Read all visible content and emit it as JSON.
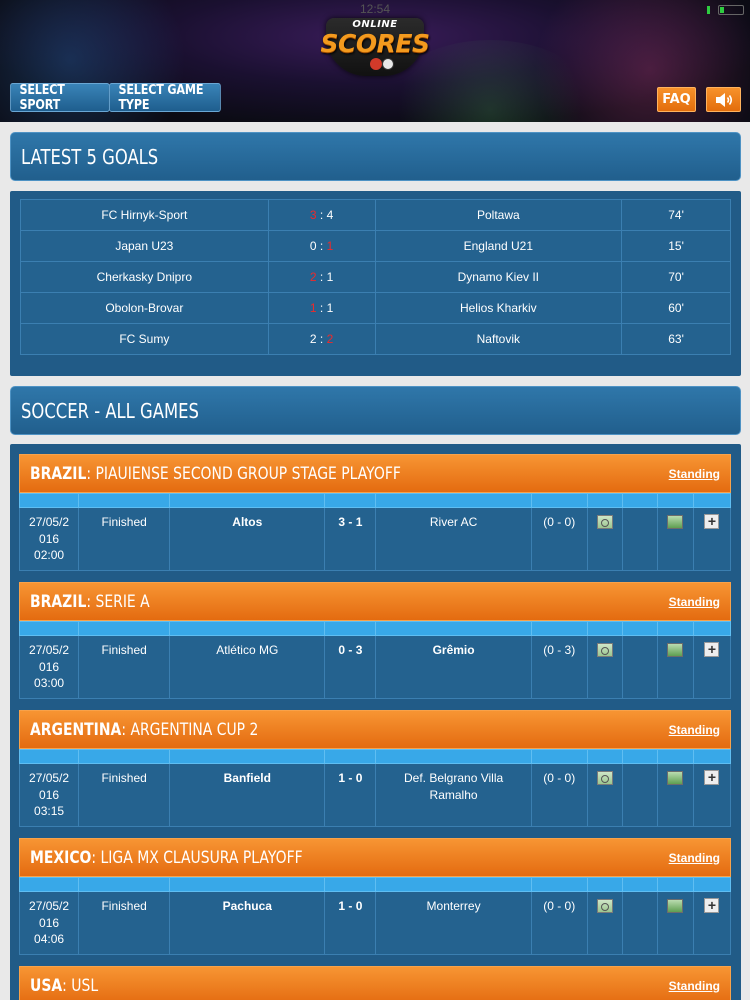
{
  "status": {
    "time": "12:54"
  },
  "header": {
    "logo_top": "ONLINE",
    "logo_main": "SCORES",
    "select_sport": "SELECT SPORT",
    "select_game_type": "SELECT GAME TYPE",
    "faq": "FAQ",
    "sound_icon": "speaker-icon"
  },
  "latest_goals": {
    "title": "LATEST 5 GOALS",
    "rows": [
      {
        "home": "FC Hirnyk-Sport",
        "home_score": "3",
        "away_score": "4",
        "away": "Poltawa",
        "minute": "74'",
        "scorer": "home"
      },
      {
        "home": "Japan U23",
        "home_score": "0",
        "away_score": "1",
        "away": "England U21",
        "minute": "15'",
        "scorer": "away"
      },
      {
        "home": "Cherkasky Dnipro",
        "home_score": "2",
        "away_score": "1",
        "away": "Dynamo Kiev II",
        "minute": "70'",
        "scorer": "home"
      },
      {
        "home": "Obolon-Brovar",
        "home_score": "1",
        "away_score": "1",
        "away": "Helios Kharkiv",
        "minute": "60'",
        "scorer": "home"
      },
      {
        "home": "FC Sumy",
        "home_score": "2",
        "away_score": "2",
        "away": "Naftovik",
        "minute": "63'",
        "scorer": "away"
      }
    ]
  },
  "soccer": {
    "title": "SOCCER - ALL GAMES",
    "leagues": [
      {
        "country": "BRAZIL",
        "name": "PIAUIENSE SECOND GROUP STAGE PLAYOFF",
        "standing": "Standing",
        "game": {
          "date1": "27/05/2",
          "date2": "016",
          "time": "02:00",
          "status": "Finished",
          "home": "Altos",
          "score": "3 - 1",
          "away": "River AC",
          "halftime": "(0 - 0)",
          "home_bold": true,
          "away_bold": false
        }
      },
      {
        "country": "BRAZIL",
        "name": "SERIE A",
        "standing": "Standing",
        "game": {
          "date1": "27/05/2",
          "date2": "016",
          "time": "03:00",
          "status": "Finished",
          "home": "Atlético MG",
          "score": "0 - 3",
          "away": "Grêmio",
          "halftime": "(0 - 3)",
          "home_bold": false,
          "away_bold": true
        }
      },
      {
        "country": "ARGENTINA",
        "name": "ARGENTINA CUP 2",
        "standing": "Standing",
        "game": {
          "date1": "27/05/2",
          "date2": "016",
          "time": "03:15",
          "status": "Finished",
          "home": "Banfield",
          "score": "1 - 0",
          "away1": "Def. Belgrano Villa",
          "away2": "Ramalho",
          "halftime": "(0 - 0)",
          "home_bold": true,
          "away_bold": false
        }
      },
      {
        "country": "MEXICO",
        "name": "LIGA MX CLAUSURA PLAYOFF",
        "standing": "Standing",
        "game": {
          "date1": "27/05/2",
          "date2": "016",
          "time": "04:06",
          "status": "Finished",
          "home": "Pachuca",
          "score": "1 - 0",
          "away": "Monterrey",
          "halftime": "(0 - 0)",
          "home_bold": true,
          "away_bold": false
        }
      },
      {
        "country": "USA",
        "name": "USL",
        "standing": "Standing"
      }
    ]
  }
}
